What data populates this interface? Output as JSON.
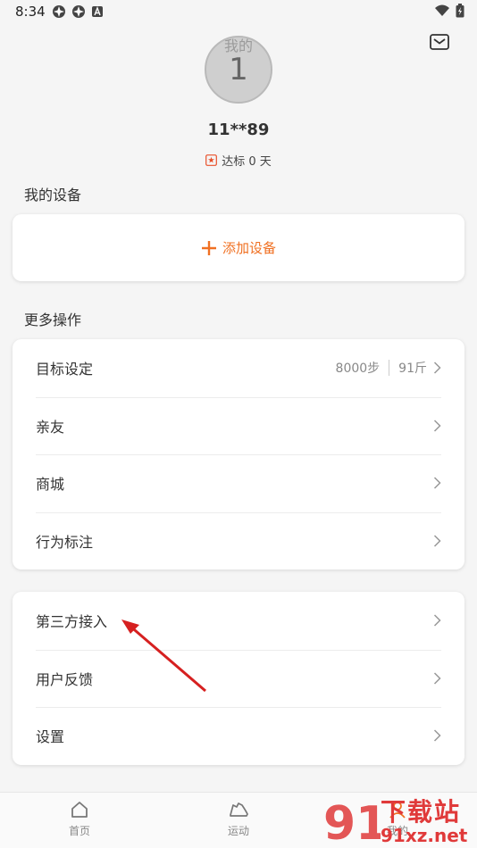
{
  "status": {
    "time": "8:34"
  },
  "profile": {
    "avatar_overlay": "我的",
    "avatar_number": "1",
    "username": "11**89",
    "target_days": "达标 0 天"
  },
  "devices": {
    "section_title": "我的设备",
    "add_label": "添加设备"
  },
  "more": {
    "section_title": "更多操作",
    "items": [
      {
        "label": "目标设定",
        "steps": "8000步",
        "weight": "91斤"
      },
      {
        "label": "亲友"
      },
      {
        "label": "商城"
      },
      {
        "label": "行为标注"
      }
    ]
  },
  "other": {
    "items": [
      {
        "label": "第三方接入"
      },
      {
        "label": "用户反馈"
      },
      {
        "label": "设置"
      }
    ]
  },
  "tabbar": {
    "tabs": [
      {
        "label": "首页"
      },
      {
        "label": "运动"
      },
      {
        "label": "我的"
      }
    ]
  },
  "watermark": {
    "text1": "下载站",
    "text2": "91xz.net"
  },
  "colors": {
    "accent": "#f07022",
    "arrow": "#d62020"
  }
}
